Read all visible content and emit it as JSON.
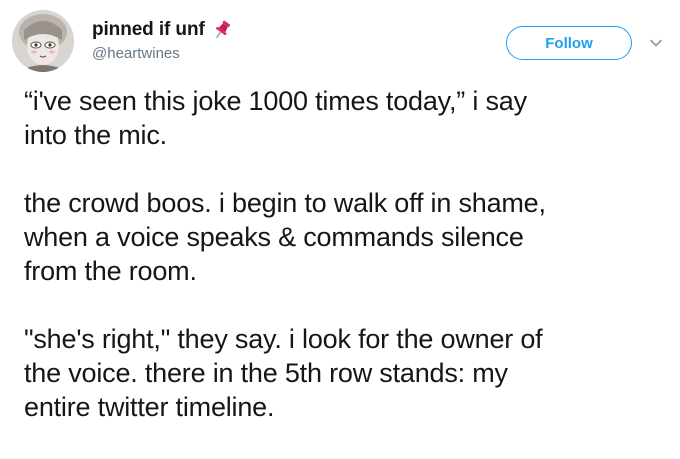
{
  "user": {
    "display_name": "pinned if unf",
    "handle": "@heartwines",
    "name_emoji": "pushpin-icon"
  },
  "actions": {
    "follow_label": "Follow",
    "more_icon": "chevron-down-icon"
  },
  "tweet": {
    "paragraphs": [
      "“i've seen this joke 1000 times today,” i say\ninto the mic.",
      "the crowd boos. i begin to walk off in shame,\nwhen a voice speaks & commands silence\nfrom the room.",
      "\"she's right,\" they say. i look for the owner of\nthe voice. there in the 5th row stands: my\nentire twitter timeline."
    ]
  },
  "colors": {
    "accent": "#1da1f2",
    "text": "#14171a",
    "secondary": "#657786",
    "pin": "#e0245e"
  }
}
